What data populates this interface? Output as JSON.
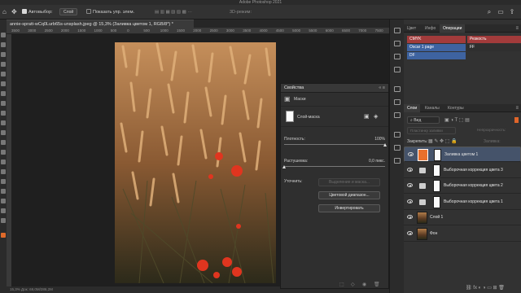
{
  "app": {
    "title": "Adobe Photoshop 2021"
  },
  "options_bar": {
    "auto_select_label": "Автовыбор:",
    "auto_select_checked": true,
    "auto_select_value": "Слой",
    "show_controls_label": "Показать упр. элем.",
    "show_controls_checked": false,
    "mode_3d_label": "3D-режим:"
  },
  "document": {
    "tab_title": "annie-spratt-wCq0Lurb65s-unsplash.jpeg @ 15,3% (Заливка цветом 1, RGB/8*) *",
    "ruler_ticks": [
      "3500",
      "3000",
      "2500",
      "2000",
      "1500",
      "1000",
      "500",
      "0",
      "500",
      "1000",
      "1500",
      "2000",
      "2500",
      "3000",
      "3500",
      "4000",
      "4500",
      "5000",
      "5500",
      "6000",
      "6500",
      "7000",
      "7500",
      "8000"
    ],
    "status": "15,3%   Док: 69,0M/286,2M"
  },
  "properties": {
    "title": "Свойства",
    "section_label": "Маски",
    "layer_mask_label": "Слой-маска",
    "density_label": "Плотность:",
    "density_value": "100%",
    "density_fraction": 1.0,
    "feather_label": "Растушевка:",
    "feather_value": "0,0 пикс.",
    "feather_fraction": 0.0,
    "refine_label": "Уточнить:",
    "select_mask_button": "Выделение и маска...",
    "color_range_button": "Цветовой диапазон...",
    "invert_button": "Инвертировать"
  },
  "right_tabs": {
    "top": [
      "Цвет",
      "Инфо",
      "Операции"
    ],
    "top_active": 2,
    "layers": [
      "Слои",
      "Каналы",
      "Контуры"
    ],
    "layers_active": 0
  },
  "actions": [
    {
      "name": "CMYK",
      "color": "#a23b3b"
    },
    {
      "name": "Резкость",
      "color": "#a23b3b"
    },
    {
      "name": "Oscar 1 page",
      "color": "#3e63a0"
    },
    {
      "name": "FF",
      "color": "#2f2f2f"
    },
    {
      "name": "DF",
      "color": "#3e63a0"
    }
  ],
  "layers_panel": {
    "filter_label": "Вид",
    "blend_mode": "Пластинку заливки",
    "opacity_label": "Непрозрачность:",
    "lock_label": "Закрепить:",
    "fill_label": "Заливка:",
    "layers": [
      {
        "name": "Заливка цветом 1",
        "type": "fill",
        "thumb_color": "#e8702c",
        "selected": true
      },
      {
        "name": "Выборочная коррекция цвета 3",
        "type": "adjust",
        "selected": false
      },
      {
        "name": "Выборочная коррекция цвета 2",
        "type": "adjust",
        "selected": false
      },
      {
        "name": "Выборочная коррекция цвета 1",
        "type": "adjust",
        "selected": false
      },
      {
        "name": "Слой 1",
        "type": "pixel",
        "selected": false
      },
      {
        "name": "Фон",
        "type": "pixel",
        "selected": false
      }
    ]
  }
}
